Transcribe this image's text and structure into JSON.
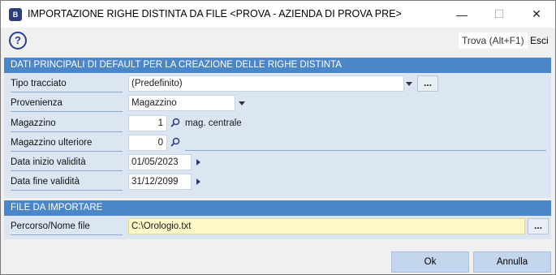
{
  "window": {
    "title": "IMPORTAZIONE RIGHE DISTINTA DA FILE <PROVA - AZIENDA DI PROVA PRE>",
    "app_icon_text": "B",
    "minimize_glyph": "—",
    "maximize_glyph": "☐",
    "close_glyph": "✕"
  },
  "toolbar": {
    "help_glyph": "?",
    "search_label": "Trova (Alt+F1)",
    "exit_label": "Esci"
  },
  "section1": {
    "header": "DATI PRINCIPALI DI DEFAULT PER LA CREAZIONE DELLE RIGHE DISTINTA",
    "tipo_tracciato": {
      "label": "Tipo tracciato",
      "value": "(Predefinito)",
      "more": "..."
    },
    "provenienza": {
      "label": "Provenienza",
      "value": "Magazzino"
    },
    "magazzino": {
      "label": "Magazzino",
      "value": "1",
      "description": "mag. centrale"
    },
    "magazzino_ulteriore": {
      "label": "Magazzino ulteriore",
      "value": "0",
      "description": ""
    },
    "data_inizio": {
      "label": "Data inizio validità",
      "value": "01/05/2023"
    },
    "data_fine": {
      "label": "Data fine validità",
      "value": "31/12/2099"
    }
  },
  "section2": {
    "header": "FILE DA IMPORTARE",
    "percorso": {
      "label": "Percorso/Nome file",
      "value": "C:\\Orologio.txt",
      "more": "..."
    }
  },
  "buttons": {
    "ok": "Ok",
    "cancel": "Annulla"
  },
  "colors": {
    "section_header": "#4a86c8",
    "section_bg": "#dce6f2",
    "file_field_bg": "#fff9c9",
    "button_bg": "#c3d6ed"
  },
  "icons": [
    "app-icon",
    "help-icon",
    "dropdown-arrow-icon",
    "search-icon",
    "arrow-right-icon"
  ]
}
